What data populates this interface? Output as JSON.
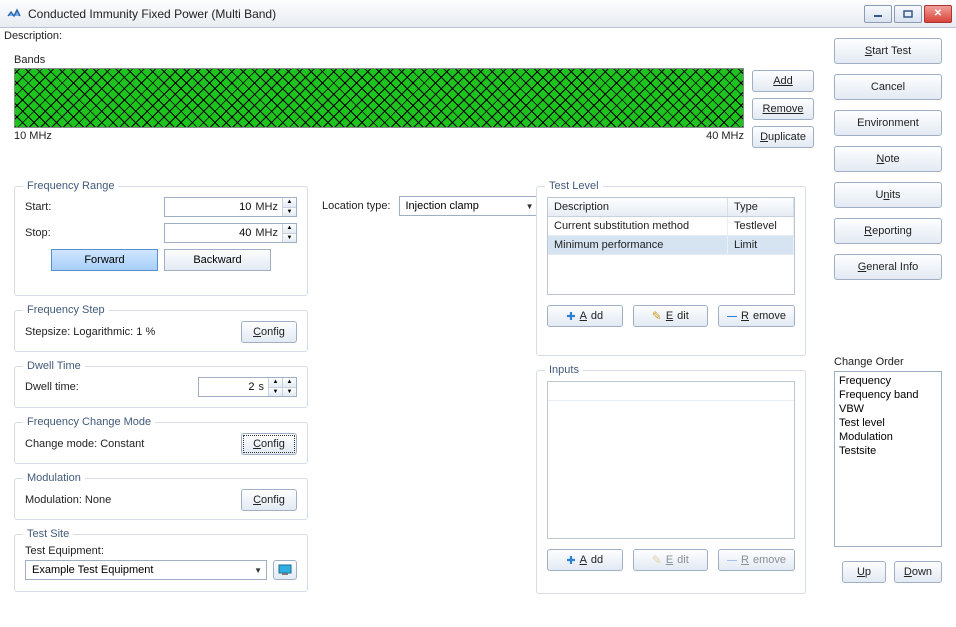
{
  "window": {
    "title": "Conducted Immunity Fixed Power (Multi Band)"
  },
  "description": {
    "label": "Description:"
  },
  "bands": {
    "label": "Bands",
    "min": "10 MHz",
    "max": "40 MHz",
    "add": "Add",
    "remove": "Remove",
    "duplicate": "Duplicate"
  },
  "right": {
    "start": "Start Test",
    "cancel": "Cancel",
    "environment": "Environment",
    "note": "Note",
    "units": "Units",
    "reporting": "Reporting",
    "general": "General Info"
  },
  "freqRange": {
    "legend": "Frequency Range",
    "startLab": "Start:",
    "stopLab": "Stop:",
    "startVal": "10",
    "startUnit": "MHz",
    "stopVal": "40",
    "stopUnit": "MHz",
    "forward": "Forward",
    "backward": "Backward"
  },
  "freqStep": {
    "legend": "Frequency Step",
    "text": "Stepsize:  Logarithmic: 1 %",
    "config": "Config"
  },
  "dwell": {
    "legend": "Dwell Time",
    "label": "Dwell time:",
    "value": "2",
    "unit": "s"
  },
  "changeMode": {
    "legend": "Frequency Change Mode",
    "text": "Change mode: Constant",
    "config": "Config"
  },
  "modulation": {
    "legend": "Modulation",
    "text": "Modulation: None",
    "config": "Config"
  },
  "testSite": {
    "legend": "Test Site",
    "label": "Test Equipment:",
    "value": "Example Test Equipment"
  },
  "location": {
    "label": "Location type:",
    "value": "Injection clamp"
  },
  "testLevel": {
    "legend": "Test Level",
    "head": {
      "desc": "Description",
      "type": "Type"
    },
    "rows": [
      {
        "desc": "Current substitution method",
        "type": "Testlevel"
      },
      {
        "desc": "Minimum performance",
        "type": "Limit"
      }
    ],
    "add": "Add",
    "edit": "Edit",
    "remove": "Remove"
  },
  "inputs": {
    "legend": "Inputs",
    "add": "Add",
    "edit": "Edit",
    "remove": "Remove"
  },
  "changeOrder": {
    "legend": "Change Order",
    "items": [
      "Frequency",
      "Frequency band",
      "VBW",
      "Test level",
      "Modulation",
      "Testsite"
    ],
    "up": "Up",
    "down": "Down"
  }
}
